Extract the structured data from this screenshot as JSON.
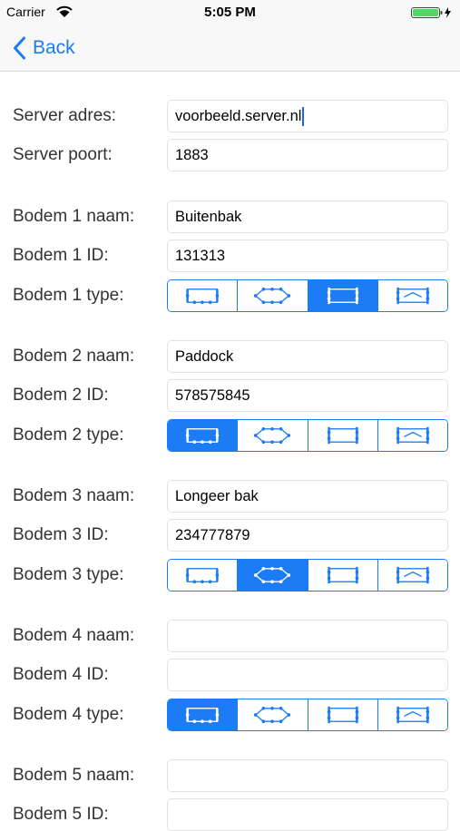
{
  "status_bar": {
    "carrier": "Carrier",
    "time": "5:05 PM"
  },
  "nav": {
    "back_label": "Back"
  },
  "server": {
    "address_label": "Server adres:",
    "address_value": "voorbeeld.server.nl",
    "port_label": "Server poort:",
    "port_value": "1883"
  },
  "bodems": [
    {
      "name_label": "Bodem 1 naam:",
      "name_value": "Buitenbak",
      "id_label": "Bodem 1 ID:",
      "id_value": "131313",
      "type_label": "Bodem 1 type:",
      "selected_type": 2
    },
    {
      "name_label": "Bodem 2 naam:",
      "name_value": "Paddock",
      "id_label": "Bodem 2 ID:",
      "id_value": "578575845",
      "type_label": "Bodem 2 type:",
      "selected_type": 0
    },
    {
      "name_label": "Bodem 3 naam:",
      "name_value": "Longeer bak",
      "id_label": "Bodem 3 ID:",
      "id_value": "234777879",
      "type_label": "Bodem 3 type:",
      "selected_type": 1
    },
    {
      "name_label": "Bodem 4 naam:",
      "name_value": "",
      "id_label": "Bodem 4 ID:",
      "id_value": "",
      "type_label": "Bodem 4 type:",
      "selected_type": 0
    },
    {
      "name_label": "Bodem 5 naam:",
      "name_value": "",
      "id_label": "Bodem 5 ID:",
      "id_value": ""
    }
  ],
  "type_options": [
    "rectangle-arena-icon",
    "octagon-arena-icon",
    "rectangle-posts-arena-icon",
    "peaked-arena-icon"
  ],
  "colors": {
    "accent": "#1b7cf5",
    "battery": "#4cd964"
  }
}
